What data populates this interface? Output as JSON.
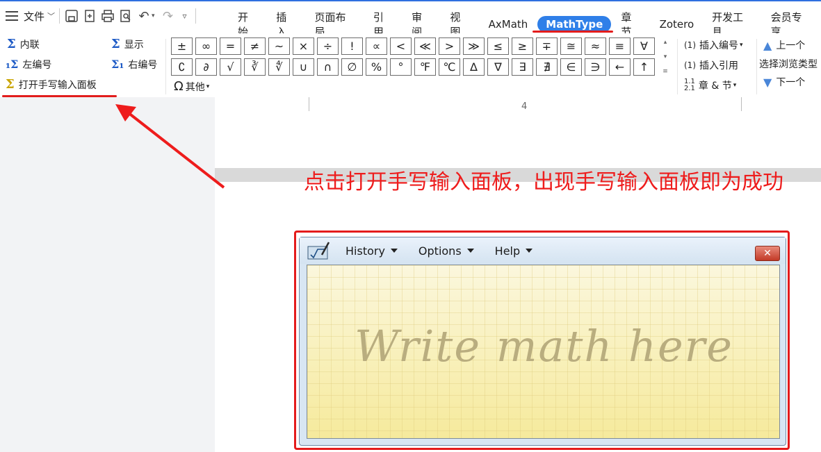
{
  "menubar": {
    "file_label": "文件",
    "tabs": [
      {
        "label": "开始"
      },
      {
        "label": "插入"
      },
      {
        "label": "页面布局"
      },
      {
        "label": "引用"
      },
      {
        "label": "审阅"
      },
      {
        "label": "视图"
      },
      {
        "label": "AxMath"
      },
      {
        "label": "MathType",
        "active": true
      },
      {
        "label": "章节"
      },
      {
        "label": "Zotero"
      },
      {
        "label": "开发工具"
      },
      {
        "label": "会员专享"
      }
    ]
  },
  "ribbon": {
    "inline": "内联",
    "display": "显示",
    "left_number": "左编号",
    "right_number": "右编号",
    "open_handwriting": "打开手写输入面板",
    "other": "其他",
    "insert_number": "插入编号",
    "insert_reference": "插入引用",
    "chapter_section": "章 & 节",
    "previous": "上一个",
    "browse_type": "选择浏览类型",
    "next": "下一个",
    "symbols_row1": [
      "±",
      "∞",
      "=",
      "≠",
      "~",
      "×",
      "÷",
      "!",
      "∝",
      "<",
      "≪",
      ">",
      "≫",
      "≤",
      "≥",
      "∓",
      "≅",
      "≈",
      "≡",
      "∀"
    ],
    "symbols_row2": [
      "∁",
      "∂",
      "√",
      "∛",
      "∜",
      "∪",
      "∩",
      "∅",
      "%",
      "°",
      "℉",
      "℃",
      "∆",
      "∇",
      "∃",
      "∄",
      "∈",
      "∋",
      "←",
      "↑"
    ]
  },
  "document": {
    "page_number": "4"
  },
  "annotation": {
    "text": "点击打开手写输入面板，出现手写输入面板即为成功"
  },
  "handwriting_panel": {
    "menus": [
      "History",
      "Options",
      "Help"
    ],
    "close_label": "✕",
    "hint": "Write math here"
  },
  "colors": {
    "accent_blue": "#2f7fe8",
    "annotation_red": "#ee1c1c"
  }
}
